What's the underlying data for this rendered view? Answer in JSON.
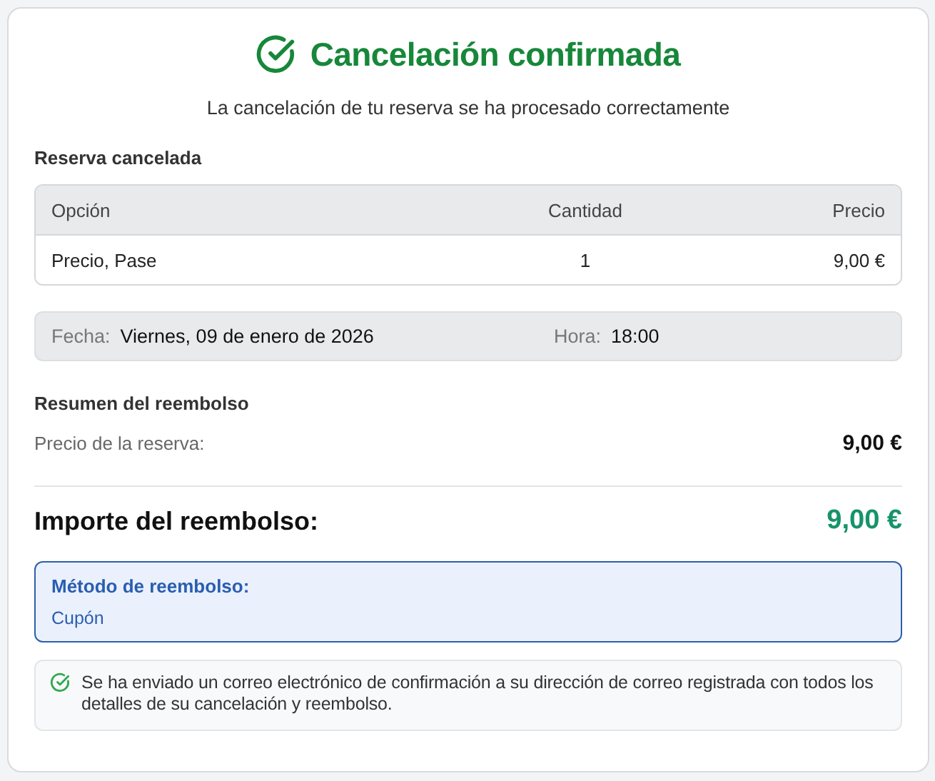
{
  "header": {
    "title": "Cancelación confirmada",
    "subtitle": "La cancelación de tu reserva se ha procesado correctamente"
  },
  "booking": {
    "heading": "Reserva cancelada",
    "table": {
      "columns": [
        "Opción",
        "Cantidad",
        "Precio"
      ],
      "rows": [
        [
          "Precio, Pase",
          "1",
          "9,00 €"
        ]
      ]
    },
    "details": [
      {
        "label": "Fecha:",
        "value": "Viernes, 09 de enero de 2026"
      },
      {
        "label": "Hora:",
        "value": "18:00"
      }
    ]
  },
  "refund": {
    "heading": "Resumen del reembolso",
    "lines": [
      {
        "label": "Precio de la reserva:",
        "value": "9,00 €"
      }
    ],
    "total": {
      "label": "Importe del reembolso:",
      "value": "9,00 €"
    },
    "method": {
      "label": "Método de reembolso:",
      "value": "Cupón"
    }
  },
  "notice": "Se ha enviado un correo electrónico de confirmación a su dirección de correo registrada con todos los detalles de su cancelación y reembolso."
}
